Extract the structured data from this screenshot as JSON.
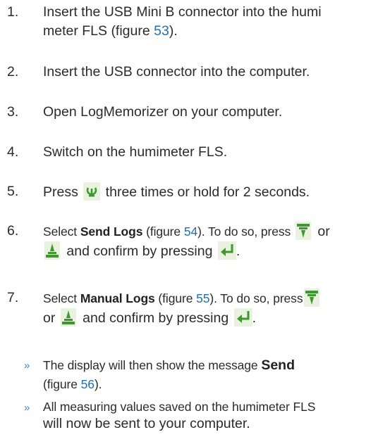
{
  "steps": [
    {
      "number": "1.",
      "text_a": "Insert the USB Mini B connector into the humi",
      "text_b": "meter FLS (figure ",
      "fig": "53",
      "text_c": ")."
    },
    {
      "number": "2.",
      "text": "Insert the USB connector into the computer."
    },
    {
      "number": "3.",
      "text": "Open LogMemorizer on your computer."
    },
    {
      "number": "4.",
      "text": "Switch on the humimeter FLS."
    },
    {
      "number": "5.",
      "text_a": "Press ",
      "text_b": " three times or hold for 2 seconds."
    },
    {
      "number": "6.",
      "pre": "Select ",
      "bold": "Send Logs",
      "mid": " (figure ",
      "fig": "54",
      "post": "). To do so, press ",
      "or": "or",
      "line2": " and confirm by pressing ",
      "end": "."
    },
    {
      "number": "7.",
      "pre": "Select ",
      "bold": "Manual Logs",
      "mid": " (figure ",
      "fig": "55",
      "post": "). To do so, press",
      "or": "or ",
      "line2": " and confirm by pressing ",
      "end": "."
    }
  ],
  "results": [
    {
      "bullet": "»",
      "pre": "The display will then show the message ",
      "bold": "Send",
      "mid": "(figure ",
      "fig": "56",
      "post": ")."
    },
    {
      "bullet": "»",
      "line1": "All measuring values saved on the humimeter FLS",
      "line2": "will now be sent to your computer."
    }
  ],
  "icons": [
    "power-refresh-icon",
    "scroll-down-icon",
    "scroll-up-icon",
    "enter-icon"
  ],
  "colors": {
    "text": "#2b2b2b",
    "link": "#1f6fb5",
    "bullet": "#3a86c8",
    "icon_green": "#3c9a2c",
    "icon_bg": "#e8f2de"
  }
}
